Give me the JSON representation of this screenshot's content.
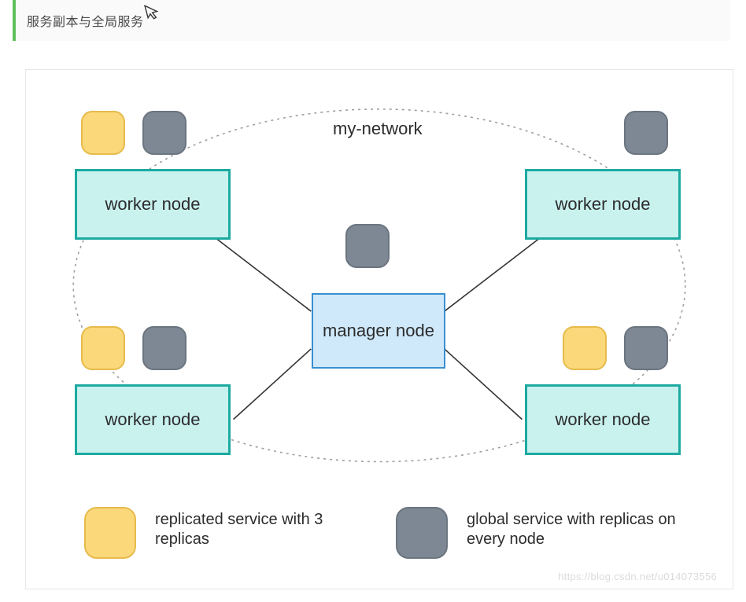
{
  "quote": {
    "text": "服务副本与全局服务"
  },
  "diagram": {
    "network_label": "my-network",
    "manager_label": "manager node",
    "workers": {
      "tl": "worker node",
      "tr": "worker node",
      "bl": "worker node",
      "br": "worker node"
    },
    "legend": {
      "replicated": "replicated service with 3 replicas",
      "global": "global service with replicas on every node"
    },
    "watermark": "https://blog.csdn.net/u014073556",
    "colors": {
      "yellow_service": "#fbd87a",
      "gray_service": "#7e8894",
      "worker_bg": "#c9f2ef",
      "worker_border": "#1daaa1",
      "manager_bg": "#cfe9fb",
      "manager_border": "#3a8fcf"
    }
  }
}
